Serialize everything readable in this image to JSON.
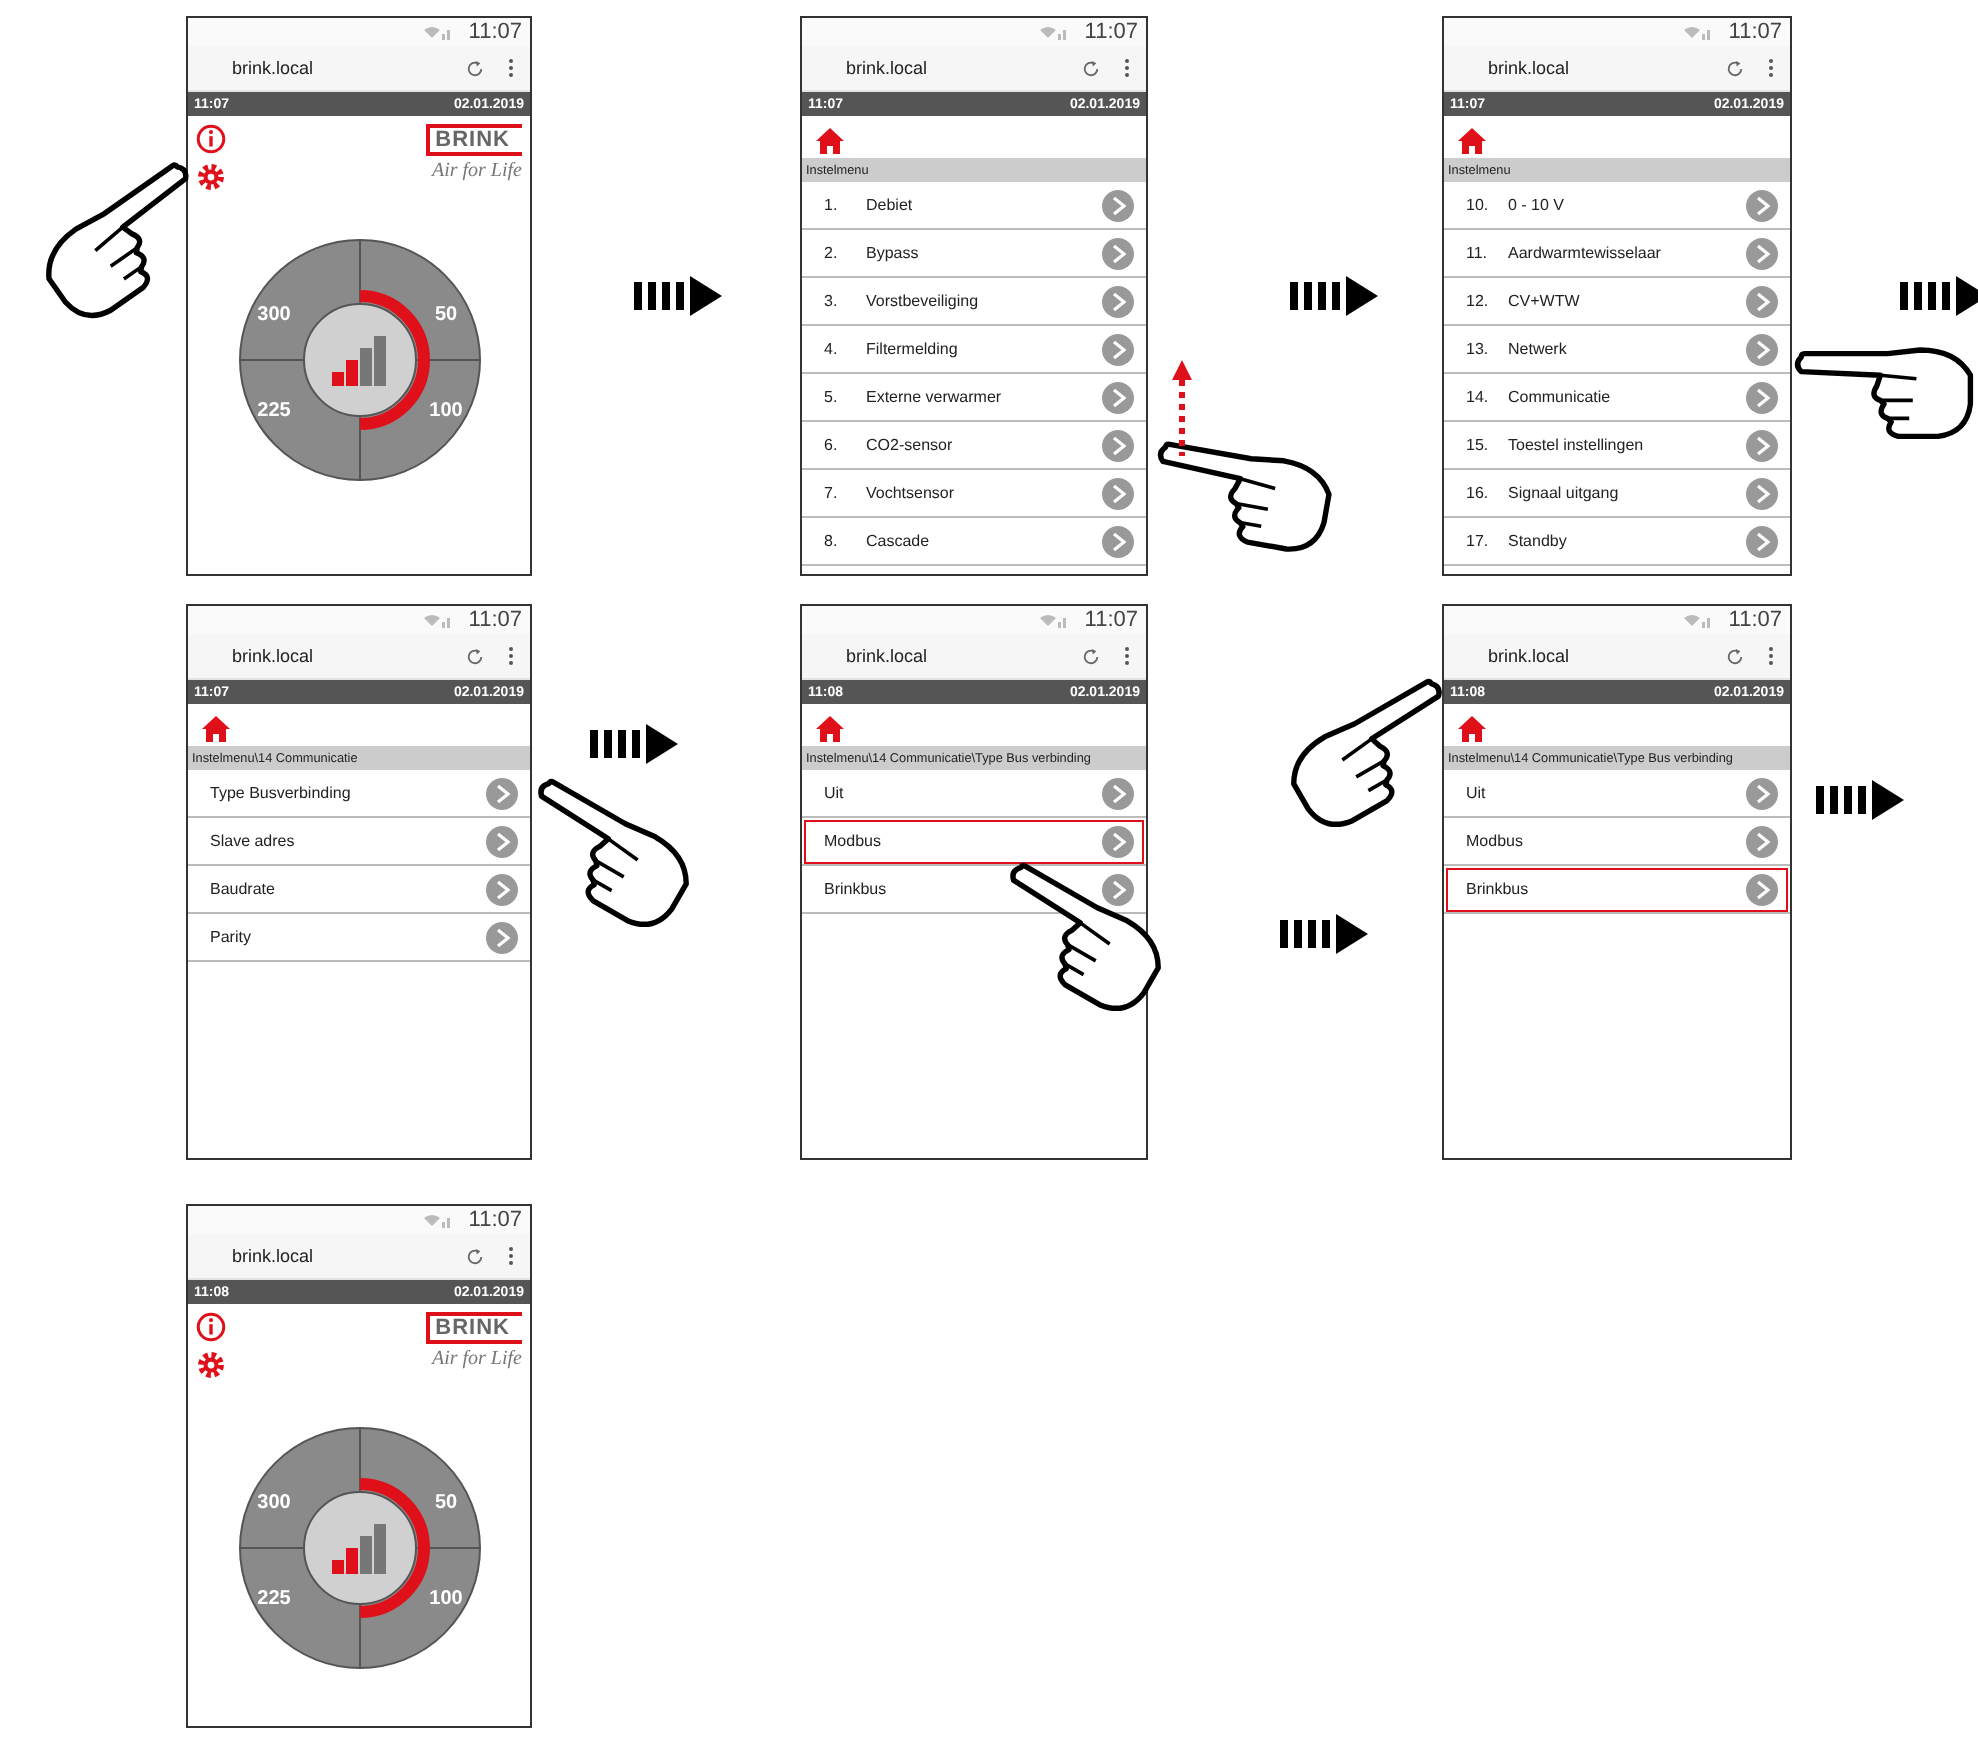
{
  "screens": [
    {
      "kind": "home",
      "status_time": "11:07",
      "url": "brink.local",
      "header_time": "11:07",
      "header_date": "02.01.2019",
      "brand": "BRINK",
      "slogan": "Air for Life",
      "dial_labels": [
        "300",
        "50",
        "225",
        "100"
      ]
    },
    {
      "kind": "menu",
      "status_time": "11:07",
      "url": "brink.local",
      "header_time": "11:07",
      "header_date": "02.01.2019",
      "breadcrumb": "Instelmenu",
      "items": [
        {
          "number": "1.",
          "label": "Debiet",
          "selected": false
        },
        {
          "number": "2.",
          "label": "Bypass",
          "selected": false
        },
        {
          "number": "3.",
          "label": "Vorstbeveiliging",
          "selected": false
        },
        {
          "number": "4.",
          "label": "Filtermelding",
          "selected": false
        },
        {
          "number": "5.",
          "label": "Externe verwarmer",
          "selected": false
        },
        {
          "number": "6.",
          "label": "CO2-sensor",
          "selected": false
        },
        {
          "number": "7.",
          "label": "Vochtsensor",
          "selected": false
        },
        {
          "number": "8.",
          "label": "Cascade",
          "selected": false
        }
      ]
    },
    {
      "kind": "menu",
      "status_time": "11:07",
      "url": "brink.local",
      "header_time": "11:07",
      "header_date": "02.01.2019",
      "breadcrumb": "Instelmenu",
      "items": [
        {
          "number": "10.",
          "label": "0 - 10 V",
          "selected": false
        },
        {
          "number": "11.",
          "label": "Aardwarmtewisselaar",
          "selected": false
        },
        {
          "number": "12.",
          "label": "CV+WTW",
          "selected": false
        },
        {
          "number": "13.",
          "label": "Netwerk",
          "selected": false
        },
        {
          "number": "14.",
          "label": "Communicatie",
          "selected": false
        },
        {
          "number": "15.",
          "label": "Toestel instellingen",
          "selected": false
        },
        {
          "number": "16.",
          "label": "Signaal uitgang",
          "selected": false
        },
        {
          "number": "17.",
          "label": "Standby",
          "selected": false
        }
      ]
    },
    {
      "kind": "menu",
      "status_time": "11:07",
      "url": "brink.local",
      "header_time": "11:07",
      "header_date": "02.01.2019",
      "breadcrumb": "Instelmenu\\14 Communicatie",
      "items": [
        {
          "label": "Type Busverbinding",
          "selected": false
        },
        {
          "label": "Slave adres",
          "selected": false
        },
        {
          "label": "Baudrate",
          "selected": false
        },
        {
          "label": "Parity",
          "selected": false
        }
      ]
    },
    {
      "kind": "menu",
      "status_time": "11:07",
      "url": "brink.local",
      "header_time": "11:08",
      "header_date": "02.01.2019",
      "breadcrumb": "Instelmenu\\14 Communicatie\\Type Bus verbinding",
      "items": [
        {
          "label": "Uit",
          "selected": false
        },
        {
          "label": "Modbus",
          "selected": true
        },
        {
          "label": "Brinkbus",
          "selected": false
        }
      ]
    },
    {
      "kind": "menu",
      "status_time": "11:07",
      "url": "brink.local",
      "header_time": "11:08",
      "header_date": "02.01.2019",
      "breadcrumb": "Instelmenu\\14 Communicatie\\Type Bus verbinding",
      "items": [
        {
          "label": "Uit",
          "selected": false
        },
        {
          "label": "Modbus",
          "selected": false
        },
        {
          "label": "Brinkbus",
          "selected": true
        }
      ]
    },
    {
      "kind": "home",
      "status_time": "11:07",
      "url": "brink.local",
      "header_time": "11:08",
      "header_date": "02.01.2019",
      "brand": "BRINK",
      "slogan": "Air for Life",
      "dial_labels": [
        "300",
        "50",
        "225",
        "100"
      ]
    }
  ]
}
